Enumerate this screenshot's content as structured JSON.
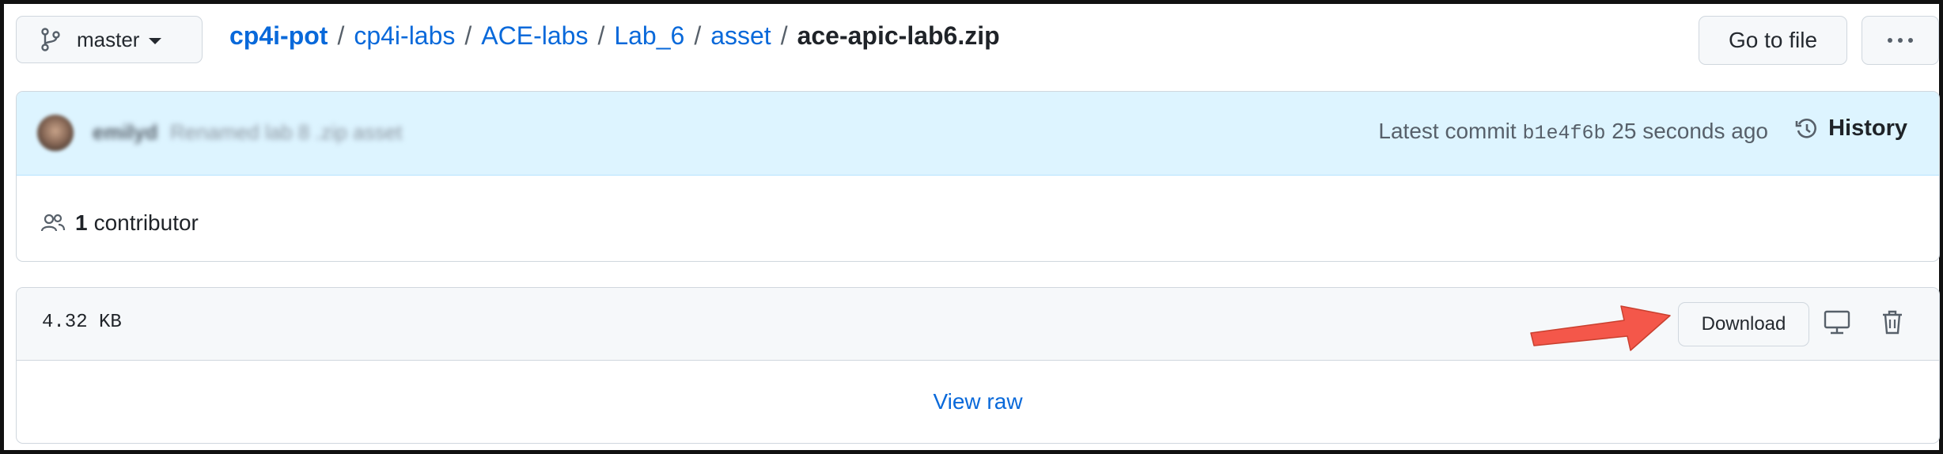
{
  "branch": {
    "label": "master"
  },
  "breadcrumb": {
    "root": "cp4i-pot",
    "parts": [
      "cp4i-labs",
      "ACE-labs",
      "Lab_6",
      "asset"
    ],
    "separator": "/",
    "current": "ace-apic-lab6.zip"
  },
  "toolbar": {
    "goto_label": "Go to file",
    "more_label": "..."
  },
  "commit": {
    "author": "emilyd",
    "message": "Renamed lab 8 .zip asset",
    "latest_prefix": "Latest commit",
    "sha": "b1e4f6b",
    "time": "25 seconds ago",
    "history_label": "History"
  },
  "contributors": {
    "count": "1",
    "label": "contributor"
  },
  "file": {
    "size": "4.32 KB",
    "download_label": "Download",
    "view_raw_label": "View raw"
  },
  "annotation": {
    "arrow_color": "#f4574a"
  },
  "colors": {
    "link": "#0969da",
    "commit_bg": "#ddf4ff",
    "header_bg": "#f6f8fa"
  }
}
